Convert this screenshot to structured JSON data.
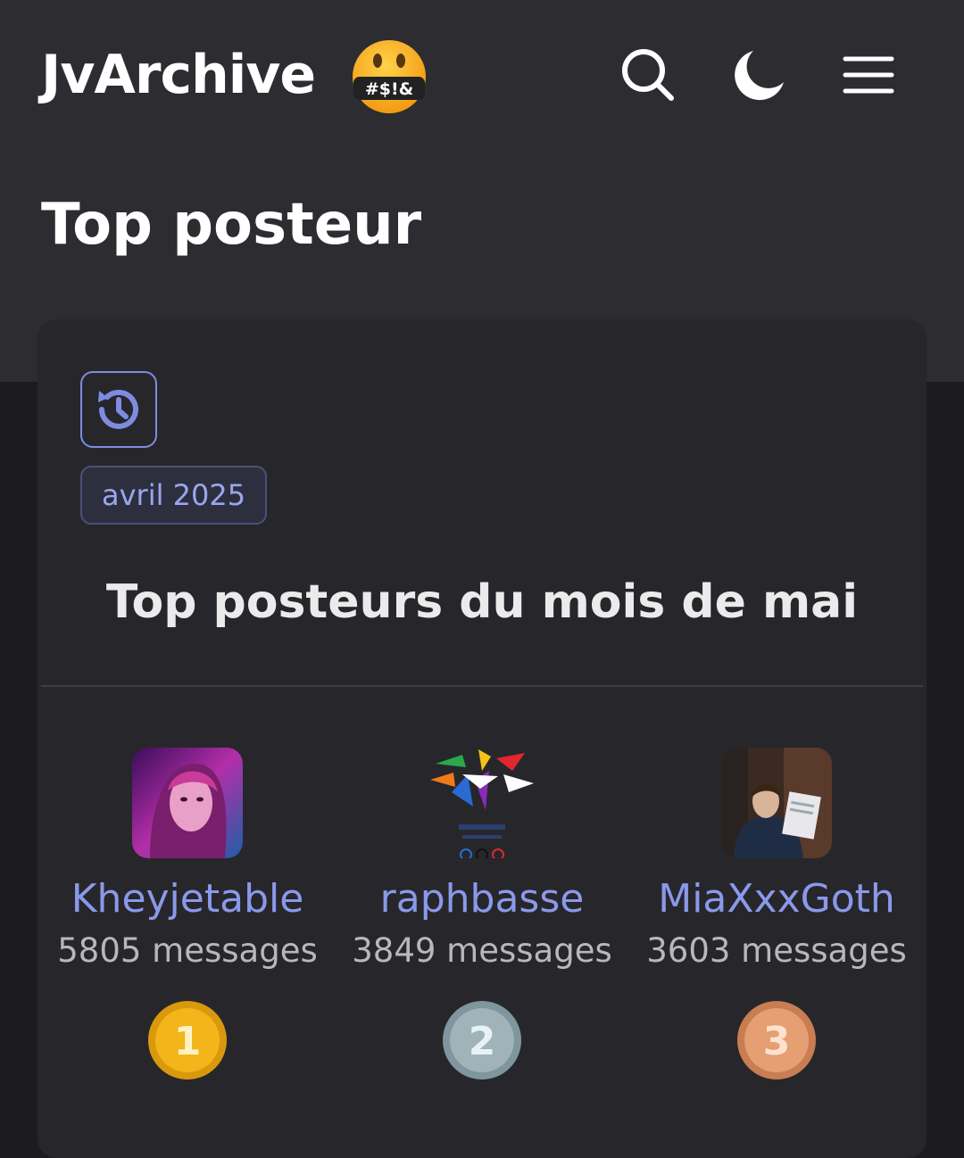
{
  "header": {
    "logo": "JvArchive",
    "emoji_icon": "censored-mouth-emoji-icon",
    "emoji_text": "#$!&",
    "icons": [
      "search-icon",
      "dark-mode-moon-icon",
      "menu-icon"
    ]
  },
  "page": {
    "title": "Top posteur"
  },
  "card": {
    "history_icon": "history-icon",
    "month_badge": "avril 2025",
    "title": "Top posteurs du mois de mai"
  },
  "posters": [
    {
      "name": "Kheyjetable",
      "count": "5805 messages",
      "rank": "1",
      "medal_color": "#f3b51a"
    },
    {
      "name": "raphbasse",
      "count": "3849 messages",
      "rank": "2",
      "medal_color": "#9fb3b9"
    },
    {
      "name": "MiaXxxGoth",
      "count": "3603 messages",
      "rank": "3",
      "medal_color": "#e59f73"
    }
  ],
  "colors": {
    "accent": "#8a99ea",
    "page_bg": "#1c1c1f",
    "hero_bg": "#2c2c31",
    "card_bg": "#27272b"
  }
}
